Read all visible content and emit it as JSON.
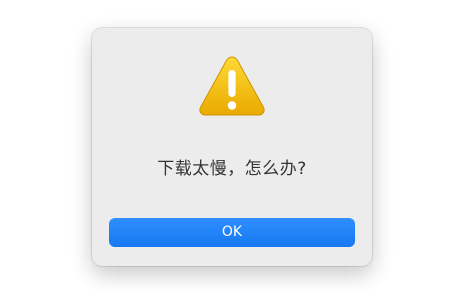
{
  "dialog": {
    "icon": "warning-icon",
    "message": "下载太慢，怎么办?",
    "ok_label": "OK"
  },
  "colors": {
    "dialog_background": "#ececec",
    "warning_yellow": "#f2c500",
    "button_blue": "#1e84ff"
  }
}
